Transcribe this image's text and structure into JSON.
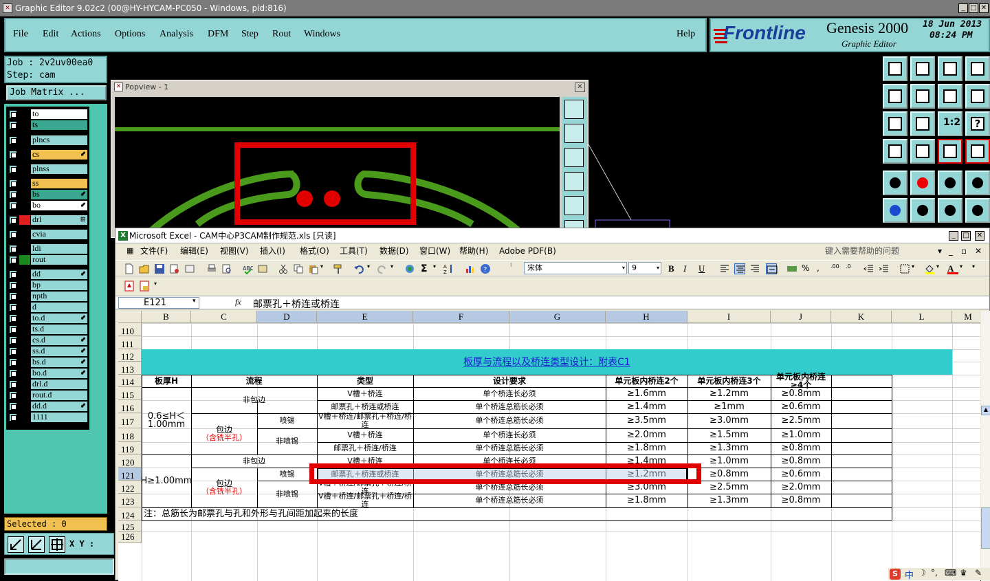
{
  "genesis": {
    "window_title": "Graphic Editor 9.02c2 (00@HY-HYCAM-PC050 - Windows, pid:816)",
    "menu": [
      "File",
      "Edit",
      "Actions",
      "Options",
      "Analysis",
      "DFM",
      "Step",
      "Rout",
      "Windows"
    ],
    "help": "Help",
    "logo_text": "Frontline",
    "product": "Genesis 2000",
    "subtitle": "Graphic Editor",
    "date": "18 Jun 2013",
    "time": "08:24 PM",
    "job_label": "Job : 2v2uv00ea0",
    "step_label": "Step: cam",
    "job_matrix": "Job Matrix ...",
    "selected": "Selected : 0",
    "xy_label": "X Y :",
    "layers": [
      {
        "name": "to",
        "color": "#000000",
        "bg": "#ffffff",
        "mark": ""
      },
      {
        "name": "ts",
        "color": "#000000",
        "bg": "#3aa890",
        "mark": ""
      },
      {
        "name": "plncs",
        "color": "#000000",
        "bg": "#94d5d5",
        "mark": ""
      },
      {
        "name": "cs",
        "color": "#000000",
        "bg": "#f0c050",
        "mark": "⬋"
      },
      {
        "name": "plnss",
        "color": "#000000",
        "bg": "#94d5d5",
        "mark": ""
      },
      {
        "name": "ss",
        "color": "#000000",
        "bg": "#f0c050",
        "mark": ""
      },
      {
        "name": "bs",
        "color": "#000000",
        "bg": "#3aa890",
        "mark": "⬋"
      },
      {
        "name": "bo",
        "color": "#000000",
        "bg": "#ffffff",
        "mark": "⬋"
      },
      {
        "name": "drl",
        "color": "#e02020",
        "bg": "#94d5d5",
        "mark": "⊞"
      },
      {
        "name": "cvia",
        "color": "#000000",
        "bg": "#94d5d5",
        "mark": ""
      },
      {
        "name": "ldi",
        "color": "#000000",
        "bg": "#94d5d5",
        "mark": ""
      },
      {
        "name": "rout",
        "color": "#1a8a20",
        "bg": "#94d5d5",
        "mark": ""
      },
      {
        "name": "dd",
        "color": "#000000",
        "bg": "#94d5d5",
        "mark": "⬋"
      },
      {
        "name": "bp",
        "color": "#000000",
        "bg": "#94d5d5",
        "mark": ""
      },
      {
        "name": "npth",
        "color": "#000000",
        "bg": "#94d5d5",
        "mark": ""
      },
      {
        "name": "d",
        "color": "#000000",
        "bg": "#94d5d5",
        "mark": ""
      },
      {
        "name": "to.d",
        "color": "#000000",
        "bg": "#94d5d5",
        "mark": "⬋"
      },
      {
        "name": "ts.d",
        "color": "#000000",
        "bg": "#94d5d5",
        "mark": ""
      },
      {
        "name": "cs.d",
        "color": "#000000",
        "bg": "#94d5d5",
        "mark": "⬋"
      },
      {
        "name": "ss.d",
        "color": "#000000",
        "bg": "#94d5d5",
        "mark": "⬋"
      },
      {
        "name": "bs.d",
        "color": "#000000",
        "bg": "#94d5d5",
        "mark": "⬋"
      },
      {
        "name": "bo.d",
        "color": "#000000",
        "bg": "#94d5d5",
        "mark": "⬋"
      },
      {
        "name": "drl.d",
        "color": "#000000",
        "bg": "#94d5d5",
        "mark": ""
      },
      {
        "name": "rout.d",
        "color": "#000000",
        "bg": "#94d5d5",
        "mark": ""
      },
      {
        "name": "dd.d",
        "color": "#000000",
        "bg": "#94d5d5",
        "mark": "⬋"
      },
      {
        "name": "1111",
        "color": "#000000",
        "bg": "#94d5d5",
        "mark": ""
      }
    ],
    "right_icons": [
      "1:2",
      "?"
    ]
  },
  "popview": {
    "title": "Popview - 1"
  },
  "excel": {
    "window_title": "Microsoft Excel - CAM中心P3CAM制作规范.xls [只读]",
    "menu": [
      "文件(F)",
      "编辑(E)",
      "视图(V)",
      "插入(I)",
      "格式(O)",
      "工具(T)",
      "数据(D)",
      "窗口(W)",
      "帮助(H)",
      "Adobe PDF(B)"
    ],
    "help_placeholder": "键入需要帮助的问题",
    "font_name": "宋体",
    "font_size": "9",
    "name_box": "E121",
    "formula": "邮票孔＋桥连或桥连",
    "fx": "fx",
    "columns": [
      "B",
      "C",
      "D",
      "E",
      "F",
      "G",
      "H",
      "I",
      "J",
      "K",
      "L",
      "M"
    ],
    "rows": [
      "110",
      "111",
      "112",
      "113",
      "114",
      "115",
      "116",
      "117",
      "118",
      "119",
      "120",
      "121",
      "122",
      "123",
      "124",
      "125",
      "126"
    ],
    "table_title": "板厚与流程以及桥连类型设计：附表C1",
    "headers": [
      "板厚H",
      "流程",
      "类型",
      "设计要求",
      "单元板内桥连2个",
      "单元板内桥连3个",
      "单元板内桥连≥4个"
    ],
    "thickness_a": "0.6≤H＜1.00mm",
    "thickness_b": "H≥1.00mm",
    "flow_no_wrap": "非包边",
    "flow_wrap": "包边",
    "flow_wrap_note": "（含铣半孔）",
    "spray": "喷锡",
    "no_spray": "非喷锡",
    "data_rows": [
      [
        "V槽＋桥连",
        "单个桥连长必须",
        "≥1.6mm",
        "≥1.2mm",
        "≥0.8mm"
      ],
      [
        "邮票孔＋桥连或桥连",
        "单个桥连总筋长必须",
        "≥1.4mm",
        "≥1mm",
        "≥0.6mm"
      ],
      [
        "V槽＋桥连/邮票孔＋桥连/桥连",
        "单个桥连总筋长必须",
        "≥3.5mm",
        "≥3.0mm",
        "≥2.5mm"
      ],
      [
        "V槽＋桥连",
        "单个桥连长必须",
        "≥2.0mm",
        "≥1.5mm",
        "≥1.0mm"
      ],
      [
        "邮票孔＋桥连/桥连",
        "单个桥连总筋长必须",
        "≥1.8mm",
        "≥1.3mm",
        "≥0.8mm"
      ],
      [
        "V槽＋桥连",
        "单个桥连长必须",
        "≥1.4mm",
        "≥1.0mm",
        "≥0.8mm"
      ],
      [
        "邮票孔＋桥连或桥连",
        "单个桥连总筋长必须",
        "≥1.2mm",
        "≥0.8mm",
        "≥0.6mm"
      ],
      [
        "V槽＋桥连/邮票孔＋桥连/桥连",
        "单个桥连总筋长必须",
        "≥3.0mm",
        "≥2.5mm",
        "≥2.0mm"
      ],
      [
        "V槽＋桥连/邮票孔＋桥连/桥连",
        "单个桥连总筋长必须",
        "≥1.8mm",
        "≥1.3mm",
        "≥0.8mm"
      ]
    ],
    "note": "注：总筋长为邮票孔与孔和外形与孔间距加起来的长度"
  },
  "tray": {
    "ime": "中"
  },
  "colors": {
    "cyan_panel": "#94d5d5",
    "green_panel": "#4fc6b0",
    "trace_green": "#4a9a1c",
    "highlight_red": "#e00000",
    "excel_title_band": "#33cccc"
  }
}
